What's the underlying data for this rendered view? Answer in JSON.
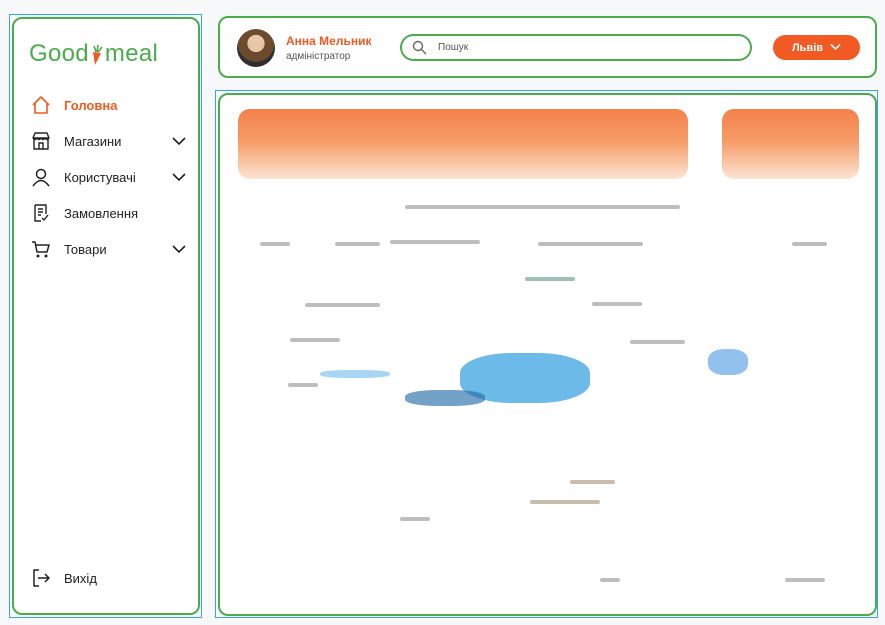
{
  "brand": {
    "logo_text_left": "Good",
    "logo_text_right": "meal"
  },
  "sidebar": {
    "items": [
      {
        "label": "Головна",
        "icon": "home-icon",
        "active": true,
        "has_submenu": false
      },
      {
        "label": "Магазини",
        "icon": "store-icon",
        "active": false,
        "has_submenu": true
      },
      {
        "label": "Користувачі",
        "icon": "user-icon",
        "active": false,
        "has_submenu": true
      },
      {
        "label": "Замовлення",
        "icon": "orders-icon",
        "active": false,
        "has_submenu": false
      },
      {
        "label": "Товари",
        "icon": "cart-icon",
        "active": false,
        "has_submenu": true
      }
    ],
    "logout_label": "Вихід"
  },
  "header": {
    "user_name": "Анна Мельник",
    "user_role": "адміністратор",
    "search_placeholder": "Пошук",
    "city": "Львів"
  },
  "colors": {
    "accent": "#f15a22",
    "brand_green": "#4cab4a",
    "frame_blue": "#3aa3e0"
  }
}
